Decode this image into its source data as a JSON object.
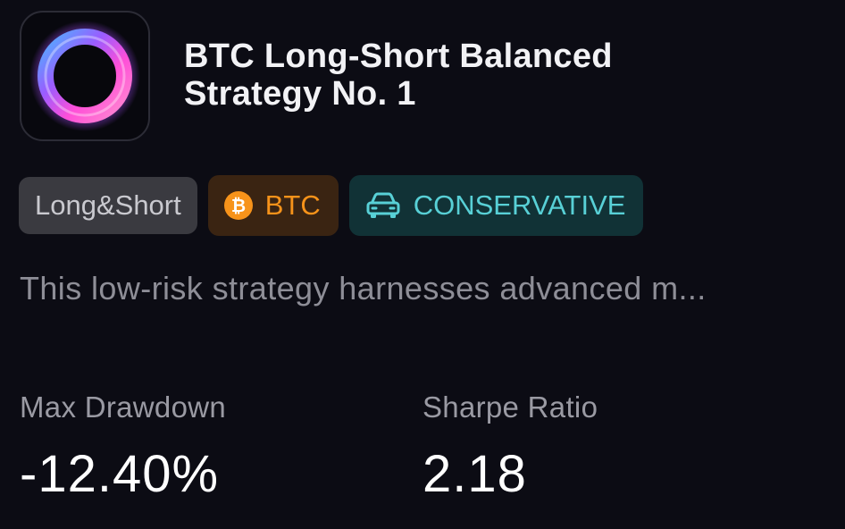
{
  "strategy": {
    "title_line1": "BTC Long-Short Balanced",
    "title_line2": "Strategy No. 1",
    "description": "This low-risk strategy harnesses advanced m..."
  },
  "tags": {
    "type": "Long&Short",
    "coin": "BTC",
    "risk": "CONSERVATIVE"
  },
  "icons": {
    "logo": "glowing-ring-icon",
    "coin": "bitcoin-icon",
    "risk": "car-icon"
  },
  "metrics": {
    "max_drawdown_label": "Max Drawdown",
    "max_drawdown_value": "-12.40%",
    "sharpe_label": "Sharpe Ratio",
    "sharpe_value": "2.18"
  },
  "colors": {
    "background": "#0c0c14",
    "coin_accent": "#f7931a",
    "risk_accent": "#58d0d6"
  }
}
